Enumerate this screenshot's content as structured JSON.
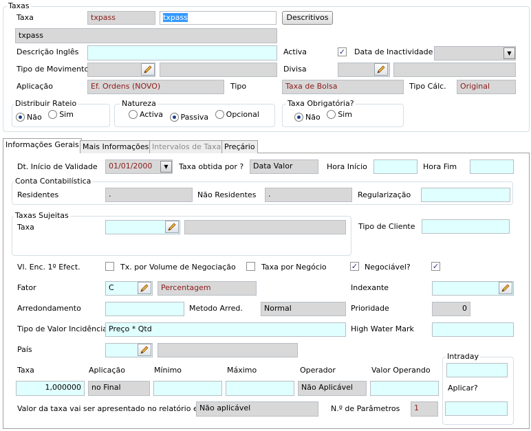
{
  "taxas": {
    "group_label": "Taxas",
    "taxa_label": "Taxa",
    "taxa_code": "txpass",
    "taxa_edit": "txpass",
    "descritivos_button": "Descritivos",
    "description": "txpass",
    "descricao_ingles_label": "Descrição Inglês",
    "descricao_ingles_value": "",
    "activa_label": "Activa",
    "activa_checked": "✓",
    "data_inactividade_label": "Data de Inactividade",
    "tipo_movimento_label": "Tipo de Movimento",
    "divisa_label": "Divisa",
    "aplicacao_label": "Aplicação",
    "aplicacao_value": "Ef. Ordens (NOVO)",
    "tipo_label": "Tipo",
    "tipo_value": "Taxa de Bolsa",
    "tipo_calc_label": "Tipo Cálc.",
    "tipo_calc_value": "Original",
    "distribuir_rateio": {
      "label": "Distribuir Rateio",
      "options": [
        "Não",
        "Sim"
      ]
    },
    "natureza": {
      "label": "Natureza",
      "options": [
        "Activa",
        "Passiva",
        "Opcional"
      ]
    },
    "taxa_obrigatoria": {
      "label": "Taxa Obrigatória?",
      "options": [
        "Não",
        "Sim"
      ]
    }
  },
  "tabs": [
    "Informações Gerais",
    "Mais Informações",
    "Intervalos de Taxa",
    "Preçário"
  ],
  "geral": {
    "dt_inicio_label": "Dt. Início de Validade",
    "dt_inicio_value": "01/01/2000",
    "taxa_obtida_label": "Taxa obtida por ?",
    "taxa_obtida_value": "Data Valor",
    "hora_inicio_label": "Hora Início",
    "hora_fim_label": "Hora Fim",
    "conta_group_label": "Conta Contabilística",
    "residentes_label": "Residentes",
    "residentes_value": ".",
    "nao_residentes_label": "Não Residentes",
    "nao_residentes_value": ".",
    "regularizacao_label": "Regularização",
    "taxas_sujeitas_label": "Taxas Sujeitas",
    "taxa_label": "Taxa",
    "tipo_cliente_label": "Tipo de Cliente",
    "vl_enc_label": "Vl. Enc. 1º Efect.",
    "tx_volume_label": "Tx. por Volume de Negociação",
    "taxa_negocio_label": "Taxa por Negócio",
    "negociavel_label": "Negociável?",
    "check_mark": "✓",
    "fator_label": "Fator",
    "fator_value": "C",
    "fator_desc": "Percentagem",
    "indexante_label": "Indexante",
    "arredondamento_label": "Arredondamento",
    "metodo_arred_label": "Metodo Arred.",
    "metodo_arred_value": "Normal",
    "prioridade_label": "Prioridade",
    "prioridade_value": "0",
    "tipo_valor_label": "Tipo de Valor Incidência",
    "tipo_valor_value": "Preço * Qtd",
    "high_water_label": "High Water Mark",
    "pais_label": "País",
    "intraday_label": "Intraday",
    "aplicar_label": "Aplicar?",
    "col_taxa": "Taxa",
    "col_aplicacao": "Aplicação",
    "col_minimo": "Mínimo",
    "col_maximo": "Máximo",
    "col_operador": "Operador",
    "col_valor_operando": "Valor Operando",
    "taxa_value": "1,000000",
    "aplicacao_value": "no Final",
    "operador_value": "Não Aplicável",
    "relatorio_label": "Valor da taxa vai ser apresentado no relatório em:",
    "relatorio_value": "Não aplicável",
    "n_parametros_label": "N.º de Parâmetros",
    "n_parametros_value": "1"
  }
}
